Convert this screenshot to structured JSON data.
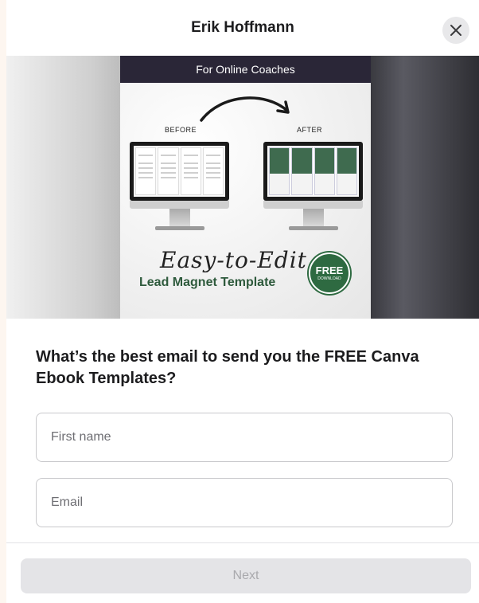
{
  "header": {
    "title": "Erik Hoffmann",
    "close_icon": "close-icon"
  },
  "banner": {
    "poster_top": "For Online Coaches",
    "before_label": "BEFORE",
    "after_label": "AFTER",
    "script_line": "Easy-to-Edit",
    "lead_line": "Lead Magnet Template",
    "badge_word": "FREE",
    "badge_sub": "DOWNLOAD",
    "accent_color": "#2e6a41"
  },
  "form": {
    "question": "What’s the best email to send you the FREE Canva Ebook Templates?",
    "first_name_placeholder": "First name",
    "email_placeholder": "Email",
    "next_label": "Next"
  }
}
